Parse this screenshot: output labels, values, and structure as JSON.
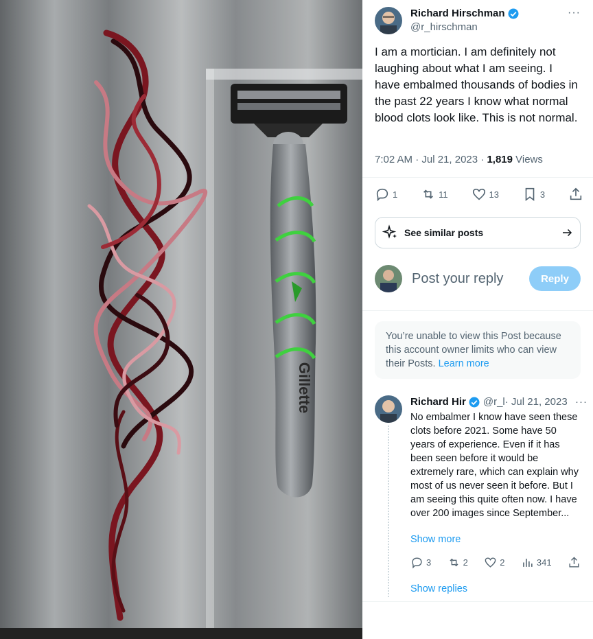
{
  "post": {
    "author_name": "Richard Hirschman",
    "author_handle": "@r_hirschman",
    "more_label": "···",
    "text": "I am a mortician. I am definitely not laughing about what I am seeing. I have embalmed thousands of bodies in the past 22 years I know what normal blood clots look like. This is not normal.",
    "time": "7:02 AM · Jul 21, 2023 · ",
    "views_count": "1,819",
    "views_label": " Views",
    "actions": {
      "replies": "1",
      "reposts": "11",
      "likes": "13",
      "bookmarks": "3"
    }
  },
  "similar": {
    "label": "See similar posts"
  },
  "reply_box": {
    "placeholder": "Post your reply",
    "button": "Reply"
  },
  "restricted": {
    "text": "You’re unable to view this Post because this account owner limits who can view their Posts. ",
    "link": "Learn more"
  },
  "reply": {
    "author_name": "Richard Hir",
    "author_handle": "@r_l",
    "date": " · Jul 21, 2023",
    "more_label": "···",
    "text": "No embalmer I know have seen these clots before 2021. Some have 50 years of experience. Even if it has been seen before it would be extremely rare, which can explain why most of us never seen it before. But I am seeing this quite often now. I have over 200 images since September...",
    "show_more": "Show more",
    "actions": {
      "replies": "3",
      "reposts": "2",
      "likes": "2",
      "views": "341"
    },
    "show_replies": "Show replies"
  },
  "photo": {
    "razor_brand": "Gillette"
  },
  "colors": {
    "accent": "#1d9bf0",
    "reply_button": "#8ecdf8",
    "text": "#0f1419",
    "muted": "#536471"
  }
}
